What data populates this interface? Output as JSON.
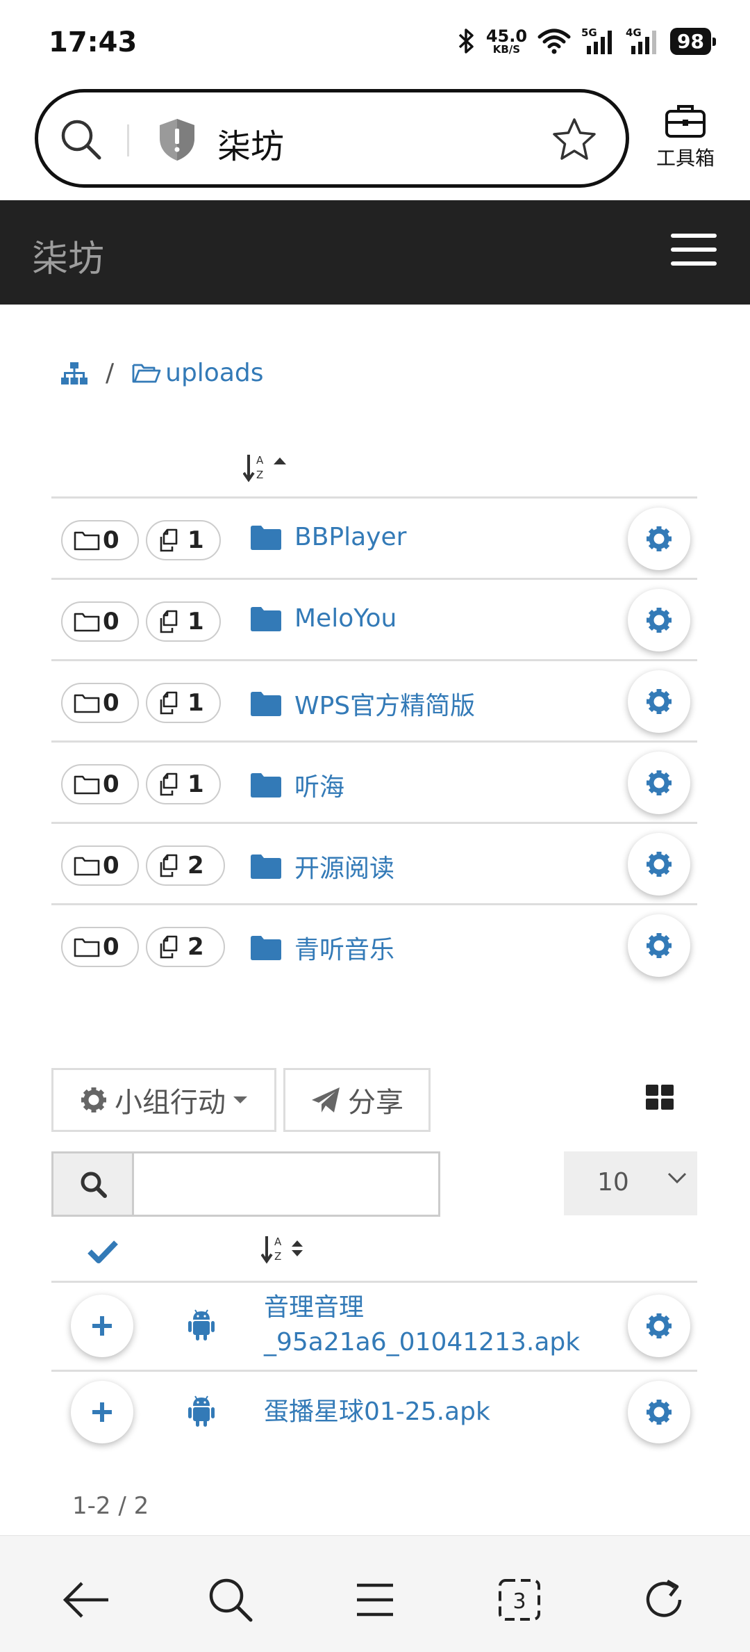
{
  "status_bar": {
    "time": "17:43",
    "net_speed_value": "45.0",
    "net_speed_unit": "KB/S",
    "signal1_label": "5G",
    "signal2_label": "4G",
    "battery": "98"
  },
  "browser": {
    "site_title": "柒坊",
    "toolbox_label": "工具箱"
  },
  "navbar": {
    "brand": "柒坊"
  },
  "breadcrumb": {
    "current": "uploads"
  },
  "folders": [
    {
      "name": "BBPlayer",
      "subfolders": "0",
      "files": "1"
    },
    {
      "name": "MeloYou",
      "subfolders": "0",
      "files": "1"
    },
    {
      "name": "WPS官方精简版",
      "subfolders": "0",
      "files": "1"
    },
    {
      "name": "听海",
      "subfolders": "0",
      "files": "1"
    },
    {
      "name": "开源阅读",
      "subfolders": "0",
      "files": "2"
    },
    {
      "name": "青听音乐",
      "subfolders": "0",
      "files": "2"
    }
  ],
  "actions": {
    "group_action_label": "小组行动",
    "share_label": "分享"
  },
  "search": {
    "value": "",
    "page_size": "10"
  },
  "files": [
    {
      "name_line1": "音理音理",
      "name_line2": "_95a21a6_01041213.apk"
    },
    {
      "name_line1": "蛋播星球01-25.apk"
    }
  ],
  "pager": {
    "summary": "1-2 / 2"
  },
  "colors": {
    "link": "#337ab7",
    "navbar_bg": "#222222",
    "brand_text": "#9d9d9d"
  },
  "icons": {
    "breadcrumb_root": "sitemap-icon",
    "folder": "folder-icon",
    "row_actions": "gear-icon",
    "file_type": "android-icon",
    "select": "plus-icon"
  }
}
